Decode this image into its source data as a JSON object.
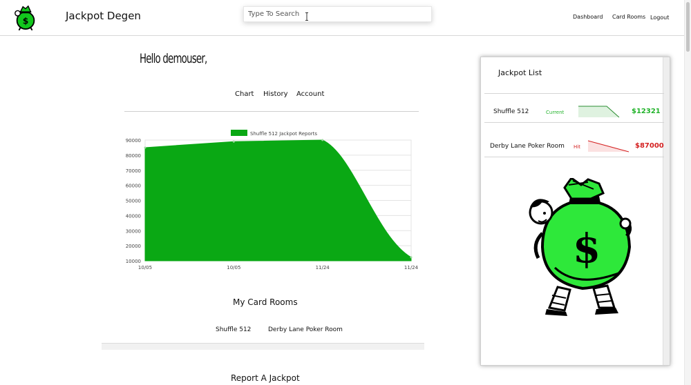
{
  "header": {
    "app_title": "Jackpot Degen",
    "search_placeholder": "Type To Search",
    "nav": [
      "Dashboard",
      "Card Rooms",
      "Logout"
    ]
  },
  "greeting": "Hello demouser,",
  "tabs": [
    "Chart",
    "History",
    "Account"
  ],
  "chart_data": {
    "type": "area",
    "legend": [
      "Shuffle 512 Jackpot Reports"
    ],
    "categories": [
      "10/05",
      "10/05",
      "11/24",
      "11/24"
    ],
    "series": [
      {
        "name": "Shuffle 512 Jackpot Reports",
        "values": [
          85000,
          89000,
          90000,
          12321
        ]
      }
    ],
    "yticks": [
      90000,
      80000,
      70000,
      60000,
      50000,
      40000,
      30000,
      20000,
      10000
    ],
    "ylim": [
      10000,
      90000
    ],
    "grid": true,
    "legend_position": "top",
    "colors": {
      "fill": "#0aa814",
      "grid": "#e3e3e3"
    }
  },
  "my_card_rooms": {
    "title": "My Card Rooms",
    "rooms": [
      "Shuffle 512",
      "Derby Lane Poker Room"
    ]
  },
  "report": {
    "title": "Report A Jackpot"
  },
  "jackpot_list": {
    "title": "Jackpot List",
    "items": [
      {
        "name": "Shuffle 512",
        "status": "Current",
        "amount": "$12321",
        "color": "#22b32b",
        "trend": "down"
      },
      {
        "name": "Derby Lane Poker Room",
        "status": "Hit",
        "amount": "$87000",
        "color": "#d42020",
        "trend": "down"
      }
    ]
  },
  "icons": [
    "money-bag-logo",
    "money-bag-illustration",
    "text-cursor-icon"
  ]
}
